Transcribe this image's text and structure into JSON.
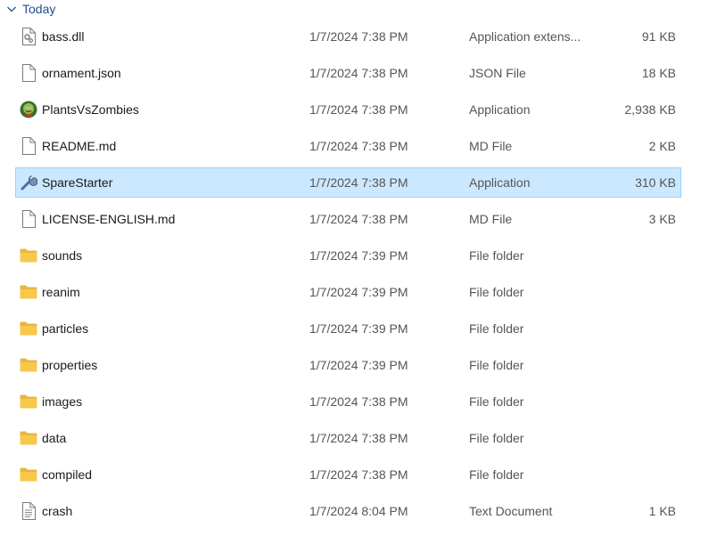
{
  "group": {
    "label": "Today"
  },
  "files": [
    {
      "name": "bass.dll",
      "date": "1/7/2024 7:38 PM",
      "type": "Application extens...",
      "size": "91 KB",
      "icon": "dll-file-icon",
      "selected": false
    },
    {
      "name": "ornament.json",
      "date": "1/7/2024 7:38 PM",
      "type": "JSON File",
      "size": "18 KB",
      "icon": "generic-file-icon",
      "selected": false
    },
    {
      "name": "PlantsVsZombies",
      "date": "1/7/2024 7:38 PM",
      "type": "Application",
      "size": "2,938 KB",
      "icon": "plants-vs-zombies-app-icon",
      "selected": false
    },
    {
      "name": "README.md",
      "date": "1/7/2024 7:38 PM",
      "type": "MD File",
      "size": "2 KB",
      "icon": "generic-file-icon",
      "selected": false
    },
    {
      "name": "SpareStarter",
      "date": "1/7/2024 7:38 PM",
      "type": "Application",
      "size": "310 KB",
      "icon": "wrench-app-icon",
      "selected": true
    },
    {
      "name": "LICENSE-ENGLISH.md",
      "date": "1/7/2024 7:38 PM",
      "type": "MD File",
      "size": "3 KB",
      "icon": "generic-file-icon",
      "selected": false
    },
    {
      "name": "sounds",
      "date": "1/7/2024 7:39 PM",
      "type": "File folder",
      "size": "",
      "icon": "folder-icon",
      "selected": false
    },
    {
      "name": "reanim",
      "date": "1/7/2024 7:39 PM",
      "type": "File folder",
      "size": "",
      "icon": "folder-icon",
      "selected": false
    },
    {
      "name": "particles",
      "date": "1/7/2024 7:39 PM",
      "type": "File folder",
      "size": "",
      "icon": "folder-icon",
      "selected": false
    },
    {
      "name": "properties",
      "date": "1/7/2024 7:39 PM",
      "type": "File folder",
      "size": "",
      "icon": "folder-icon",
      "selected": false
    },
    {
      "name": "images",
      "date": "1/7/2024 7:38 PM",
      "type": "File folder",
      "size": "",
      "icon": "folder-icon",
      "selected": false
    },
    {
      "name": "data",
      "date": "1/7/2024 7:38 PM",
      "type": "File folder",
      "size": "",
      "icon": "folder-icon",
      "selected": false
    },
    {
      "name": "compiled",
      "date": "1/7/2024 7:38 PM",
      "type": "File folder",
      "size": "",
      "icon": "folder-icon",
      "selected": false
    },
    {
      "name": "crash",
      "date": "1/7/2024 8:04 PM",
      "type": "Text Document",
      "size": "1 KB",
      "icon": "text-document-icon",
      "selected": false
    }
  ],
  "colors": {
    "selection_bg": "#cce8ff",
    "selection_border": "#99d1ff",
    "group_header": "#1f4e8c",
    "folder": "#f8c84a"
  }
}
